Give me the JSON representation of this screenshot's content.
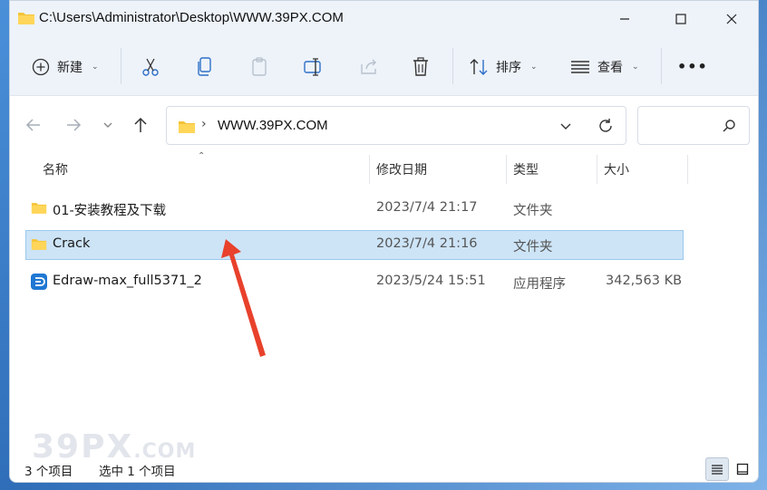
{
  "window": {
    "title": "C:\\Users\\Administrator\\Desktop\\WWW.39PX.COM"
  },
  "toolbar": {
    "new_label": "新建",
    "sort_label": "排序",
    "view_label": "查看",
    "more_label": "•••"
  },
  "address": {
    "path": "WWW.39PX.COM"
  },
  "search": {
    "placeholder": ""
  },
  "columns": {
    "name": "名称",
    "modified": "修改日期",
    "type": "类型",
    "size": "大小"
  },
  "files": [
    {
      "name": "01-安装教程及下载",
      "modified": "2023/7/4 21:17",
      "type": "文件夹",
      "size": ""
    },
    {
      "name": "Crack",
      "modified": "2023/7/4 21:16",
      "type": "文件夹",
      "size": ""
    },
    {
      "name": "Edraw-max_full5371_2",
      "modified": "2023/5/24 15:51",
      "type": "应用程序",
      "size": "342,563 KB"
    }
  ],
  "status": {
    "item_count": "3 个项目",
    "selected": "选中 1 个项目"
  },
  "watermark": {
    "main": "39PX",
    "suffix": ".COM"
  },
  "colors": {
    "folder": "#f5c338",
    "selection": "#cde4f7",
    "arrow": "#e8412c"
  }
}
